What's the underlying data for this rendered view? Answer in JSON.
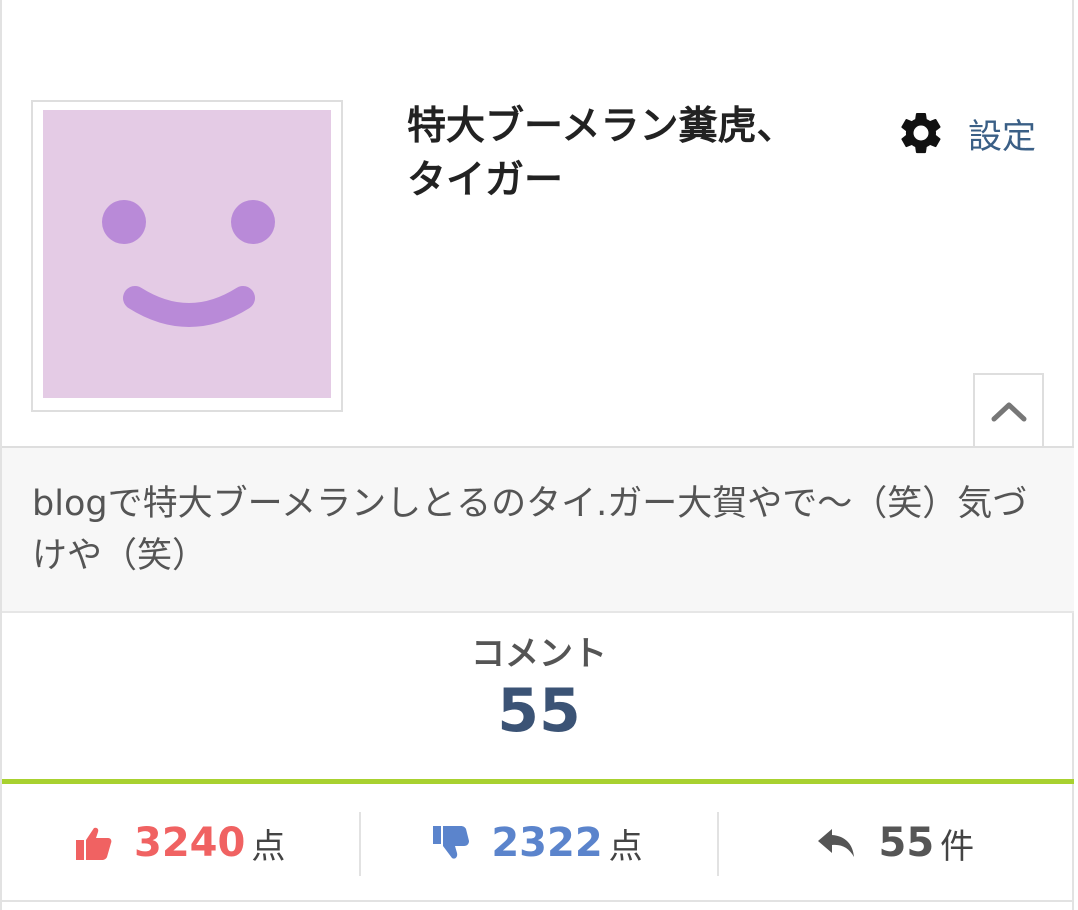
{
  "profile": {
    "username": "特大ブーメラン糞虎、タイガー",
    "settings_label": "設定",
    "bio": "blogで特大ブーメランしとるのタイ.ガー大賀やで～（笑）気づけや（笑）"
  },
  "comments": {
    "label": "コメント",
    "count": "55"
  },
  "stats": {
    "likes": {
      "value": "3240",
      "unit": "点",
      "color": "#f06262",
      "icon": "thumbs-up-icon"
    },
    "dislikes": {
      "value": "2322",
      "unit": "点",
      "color": "#5b84cc",
      "icon": "thumbs-down-icon"
    },
    "replies": {
      "value": "55",
      "unit": "件",
      "color": "#555555",
      "icon": "reply-icon"
    }
  },
  "colors": {
    "avatar_bg": "#e4cbe5",
    "avatar_face": "#b98ad8",
    "accent_line": "#a8d130",
    "link": "#3a5f86",
    "count": "#3b5375"
  }
}
